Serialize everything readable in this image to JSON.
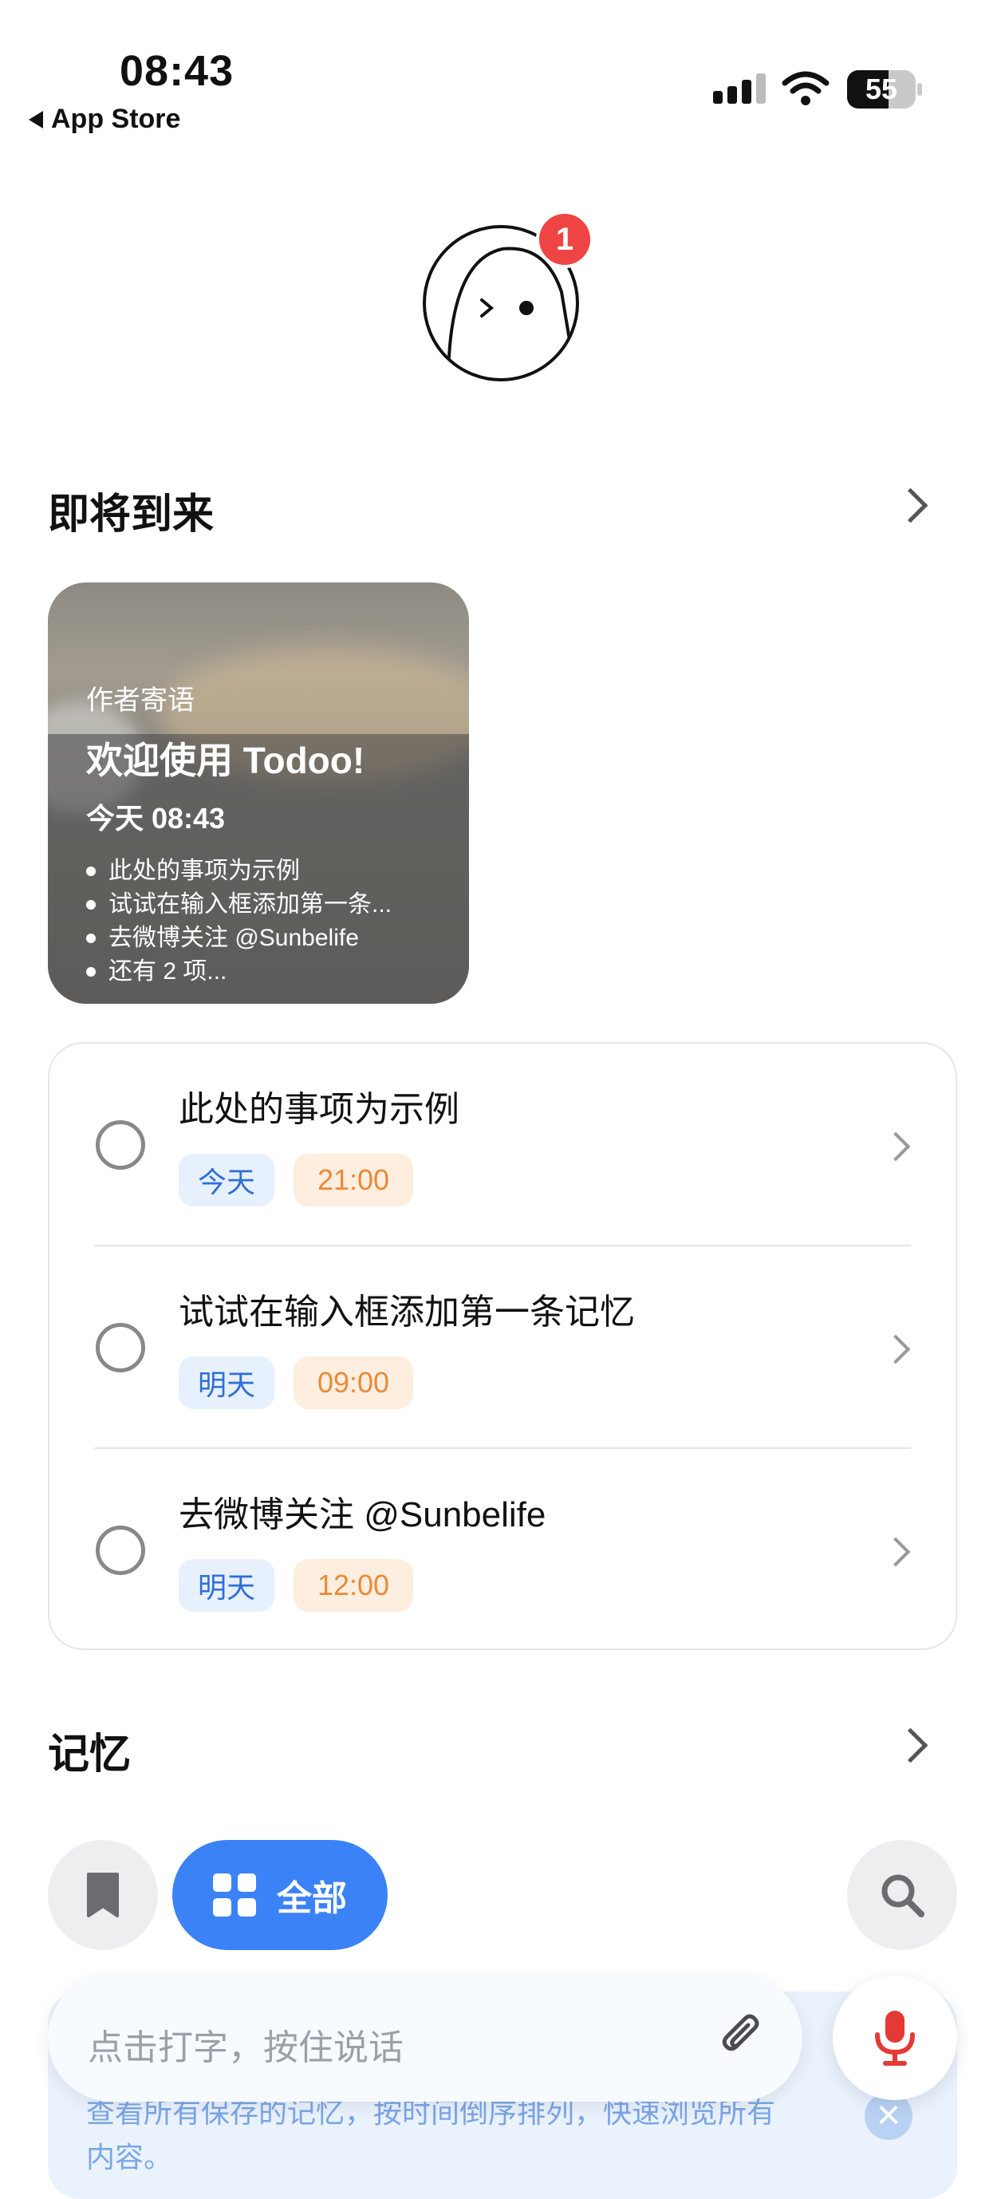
{
  "status_bar": {
    "time": "08:43",
    "back_app": "App Store",
    "battery": "55"
  },
  "avatar": {
    "badge_count": "1"
  },
  "upcoming": {
    "title": "即将到来",
    "card": {
      "kicker": "作者寄语",
      "title": "欢迎使用 Todoo!",
      "time": "今天 08:43",
      "items": [
        "此处的事项为示例",
        "试试在输入框添加第一条...",
        "去微博关注 @Sunbelife",
        "还有 2 项..."
      ]
    }
  },
  "todos": [
    {
      "text": "此处的事项为示例",
      "day": "今天",
      "time": "21:00"
    },
    {
      "text": "试试在输入框添加第一条记忆",
      "day": "明天",
      "time": "09:00"
    },
    {
      "text": "去微博关注 @Sunbelife",
      "day": "明天",
      "time": "12:00"
    }
  ],
  "memory": {
    "title": "记忆"
  },
  "toolbar": {
    "all_label": "全部"
  },
  "hint": {
    "text": "查看所有保存的记忆，按时间倒序排列，快速浏览所有内容。"
  },
  "input": {
    "placeholder": "点击打字，按住说话"
  },
  "colors": {
    "accent": "#3b82f6",
    "badge": "#ef4444",
    "day_tag": "#2f6fd6",
    "time_tag": "#ea8b35"
  }
}
